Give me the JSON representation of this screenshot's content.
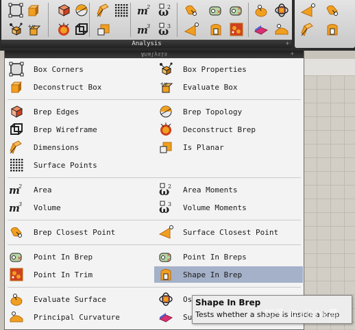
{
  "ribbon": {
    "tab_label": "Analysis",
    "pin_glyph": "+",
    "icons_left": [
      "box-corners-icon",
      "deconstruct-box-icon",
      "brep-edges-icon",
      "brep-topology-icon",
      "dimensions-icon",
      "surface-points-icon",
      "area-icon",
      "area-moments-icon",
      "brep-closest-point-icon",
      "point-in-brep-icon",
      "point-in-breps-icon",
      "evaluate-surface-icon",
      "osculating-circles-icon",
      "box-properties-icon",
      "evaluate-box-icon",
      "deconstruct-brep-icon",
      "brep-wireframe-icon",
      "is-planar-icon",
      "volume-icon",
      "volume-moments-icon",
      "surface-closest-point-icon",
      "shape-in-brep-icon",
      "point-in-trim-icon",
      "surface-curvature-icon",
      "principal-curvature-icon"
    ]
  },
  "dropdown": {
    "header": "Analysis",
    "pin_glyph": "+",
    "groups": [
      {
        "left": [
          {
            "label": "Box Corners",
            "icon": "box-corners-icon"
          },
          {
            "label": "Deconstruct Box",
            "icon": "deconstruct-box-icon"
          }
        ],
        "right": [
          {
            "label": "Box Properties",
            "icon": "box-properties-icon"
          },
          {
            "label": "Evaluate Box",
            "icon": "evaluate-box-icon"
          }
        ]
      },
      {
        "left": [
          {
            "label": "Brep Edges",
            "icon": "brep-edges-icon"
          },
          {
            "label": "Brep Wireframe",
            "icon": "brep-wireframe-icon"
          },
          {
            "label": "Dimensions",
            "icon": "dimensions-icon"
          },
          {
            "label": "Surface Points",
            "icon": "surface-points-icon"
          }
        ],
        "right": [
          {
            "label": "Brep Topology",
            "icon": "brep-topology-icon"
          },
          {
            "label": "Deconstruct Brep",
            "icon": "deconstruct-brep-icon"
          },
          {
            "label": "Is Planar",
            "icon": "is-planar-icon"
          }
        ]
      },
      {
        "left": [
          {
            "label": "Area",
            "icon": "area-icon"
          },
          {
            "label": "Volume",
            "icon": "volume-icon"
          }
        ],
        "right": [
          {
            "label": "Area Moments",
            "icon": "area-moments-icon"
          },
          {
            "label": "Volume Moments",
            "icon": "volume-moments-icon"
          }
        ]
      },
      {
        "left": [
          {
            "label": "Brep Closest Point",
            "icon": "brep-closest-point-icon"
          }
        ],
        "right": [
          {
            "label": "Surface Closest Point",
            "icon": "surface-closest-point-icon"
          }
        ]
      },
      {
        "left": [
          {
            "label": "Point In Brep",
            "icon": "point-in-brep-icon"
          },
          {
            "label": "Point In Trim",
            "icon": "point-in-trim-icon"
          }
        ],
        "right": [
          {
            "label": "Point In Breps",
            "icon": "point-in-breps-icon"
          },
          {
            "label": "Shape In Brep",
            "icon": "shape-in-brep-icon",
            "active": true
          }
        ]
      },
      {
        "left": [
          {
            "label": "Evaluate Surface",
            "icon": "evaluate-surface-icon"
          },
          {
            "label": "Principal Curvature",
            "icon": "principal-curvature-icon"
          }
        ],
        "right": [
          {
            "label": "Os",
            "icon": "osculating-circles-icon"
          },
          {
            "label": "Su",
            "icon": "surface-curvature-icon"
          }
        ]
      }
    ]
  },
  "tooltip": {
    "title": "Shape In Brep",
    "description": "Tests whether a shape is inside a brep"
  },
  "watermark": "知乎 @alkhe茜",
  "colors": {
    "highlight": "#a4b1c9",
    "menu_bg": "#f3f3f3",
    "icon_orange": "#f0a020",
    "icon_red": "#d04020"
  }
}
